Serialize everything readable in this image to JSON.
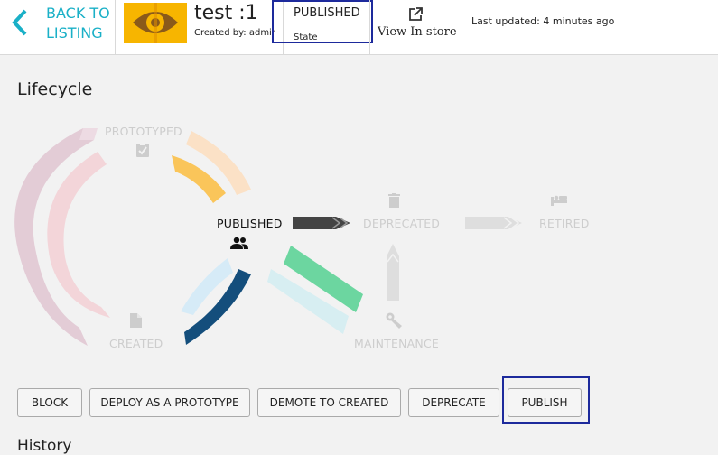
{
  "header": {
    "back_line1": "BACK TO",
    "back_line2": "LISTING",
    "title": "test :1",
    "created_by": "Created by: admin",
    "state_value": "PUBLISHED",
    "state_label": "State",
    "view_in_store": "View In store",
    "last_updated": "Last updated: 4 minutes ago",
    "accent_color": "#1ab0c7",
    "thumbnail_color": "#f7b500"
  },
  "lifecycle": {
    "title": "Lifecycle",
    "current_state": "PUBLISHED",
    "states": {
      "prototyped": "PROTOTYPED",
      "published": "PUBLISHED",
      "deprecated": "DEPRECATED",
      "retired": "RETIRED",
      "created": "CREATED",
      "maintenance": "MAINTENANCE"
    },
    "icons": {
      "prototyped": "clipboard-check-icon",
      "published": "users-icon",
      "deprecated": "trash-icon",
      "retired": "bed-icon",
      "created": "file-icon",
      "maintenance": "wrench-icon"
    }
  },
  "actions": [
    "BLOCK",
    "DEPLOY AS A PROTOTYPE",
    "DEMOTE TO CREATED",
    "DEPRECATE",
    "PUBLISH"
  ],
  "history": {
    "title": "History"
  }
}
